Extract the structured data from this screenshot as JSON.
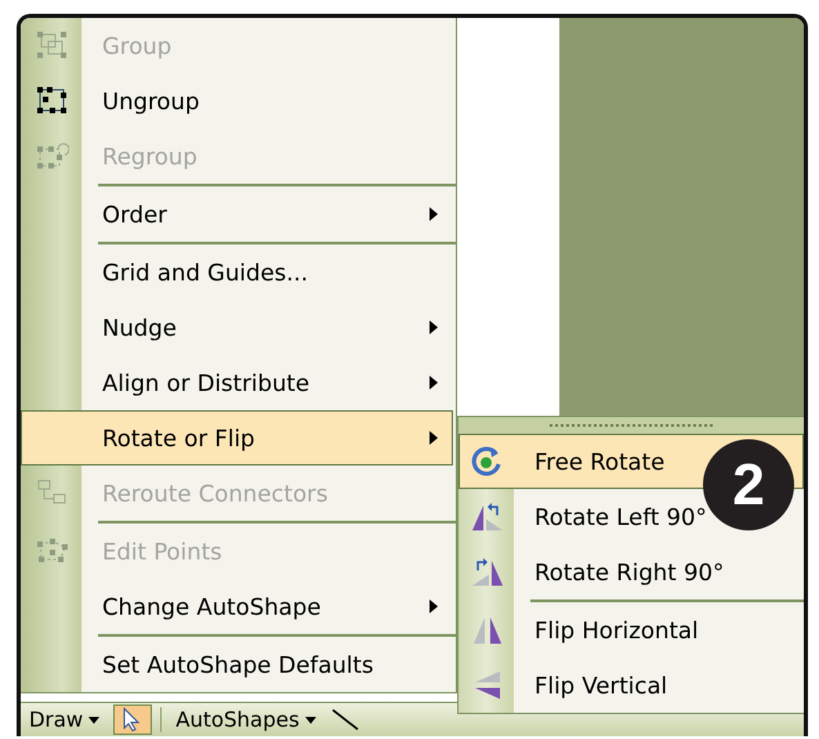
{
  "menu": {
    "groups": [
      [
        {
          "label": "Group",
          "kind": "group",
          "disabled": true,
          "submenu": false,
          "selected": false
        },
        {
          "label": "Ungroup",
          "kind": "ungroup",
          "disabled": false,
          "submenu": false,
          "selected": false
        },
        {
          "label": "Regroup",
          "kind": "regroup",
          "disabled": true,
          "submenu": false,
          "selected": false
        }
      ],
      [
        {
          "label": "Order",
          "kind": "plain",
          "disabled": false,
          "submenu": true,
          "selected": false
        }
      ],
      [
        {
          "label": "Grid and Guides...",
          "kind": "plain",
          "disabled": false,
          "submenu": false,
          "selected": false
        },
        {
          "label": "Nudge",
          "kind": "plain",
          "disabled": false,
          "submenu": true,
          "selected": false
        },
        {
          "label": "Align or Distribute",
          "kind": "plain",
          "disabled": false,
          "submenu": true,
          "selected": false
        },
        {
          "label": "Rotate or Flip",
          "kind": "plain",
          "disabled": false,
          "submenu": true,
          "selected": true
        },
        {
          "label": "Reroute Connectors",
          "kind": "reroute",
          "disabled": true,
          "submenu": false,
          "selected": false
        }
      ],
      [
        {
          "label": "Edit Points",
          "kind": "points",
          "disabled": true,
          "submenu": false,
          "selected": false
        },
        {
          "label": "Change AutoShape",
          "kind": "plain",
          "disabled": false,
          "submenu": true,
          "selected": false
        }
      ],
      [
        {
          "label": "Set AutoShape Defaults",
          "kind": "plain",
          "disabled": false,
          "submenu": false,
          "selected": false
        }
      ]
    ]
  },
  "submenu": {
    "groups": [
      [
        {
          "label": "Free Rotate",
          "kind": "free",
          "selected": true
        },
        {
          "label": "Rotate Left 90°",
          "kind": "left",
          "selected": false
        },
        {
          "label": "Rotate Right 90°",
          "kind": "right",
          "selected": false
        }
      ],
      [
        {
          "label": "Flip Horizontal",
          "kind": "horizontal",
          "selected": false
        },
        {
          "label": "Flip Vertical",
          "kind": "vertical",
          "selected": false
        }
      ]
    ]
  },
  "toolbar": {
    "draw": "Draw",
    "autoshapes": "AutoShapes"
  },
  "badge": "2"
}
